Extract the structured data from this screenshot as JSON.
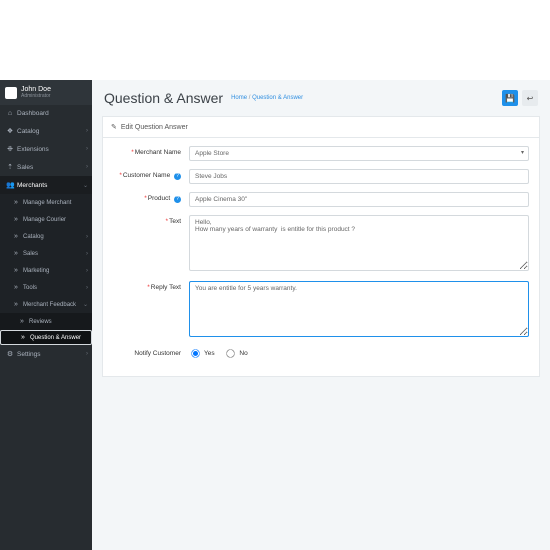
{
  "user": {
    "name": "John Doe",
    "role": "Administrator"
  },
  "nav": {
    "dashboard": "Dashboard",
    "catalog": "Catalog",
    "extensions": "Extensions",
    "sales": "Sales",
    "merchants": "Merchants",
    "manage_merchant": "Manage Merchant",
    "manage_courier": "Manage Courier",
    "m_catalog": "Catalog",
    "m_sales": "Sales",
    "marketing": "Marketing",
    "tools": "Tools",
    "merchant_feedback": "Merchant Feedback",
    "reviews": "Reviews",
    "qa": "Question & Answer",
    "settings": "Settings"
  },
  "header": {
    "title": "Question & Answer",
    "bc_home": "Home",
    "bc_sep": " / ",
    "bc_current": "Question & Answer"
  },
  "panel": {
    "title": "Edit Question Answer"
  },
  "form": {
    "merchant_label": "Merchant Name",
    "merchant_value": "Apple Store",
    "customer_label": "Customer Name",
    "customer_value": "Steve Jobs",
    "product_label": "Product",
    "product_value": "Apple Cinema 30\"",
    "text_label": "Text",
    "text_value": "Hello,\nHow many years of warranty  is entitle for this product ?",
    "reply_label": "Reply Text",
    "reply_value": "You are entitle for 5 years warranty.",
    "notify_label": "Notify Customer",
    "yes": "Yes",
    "no": "No"
  }
}
